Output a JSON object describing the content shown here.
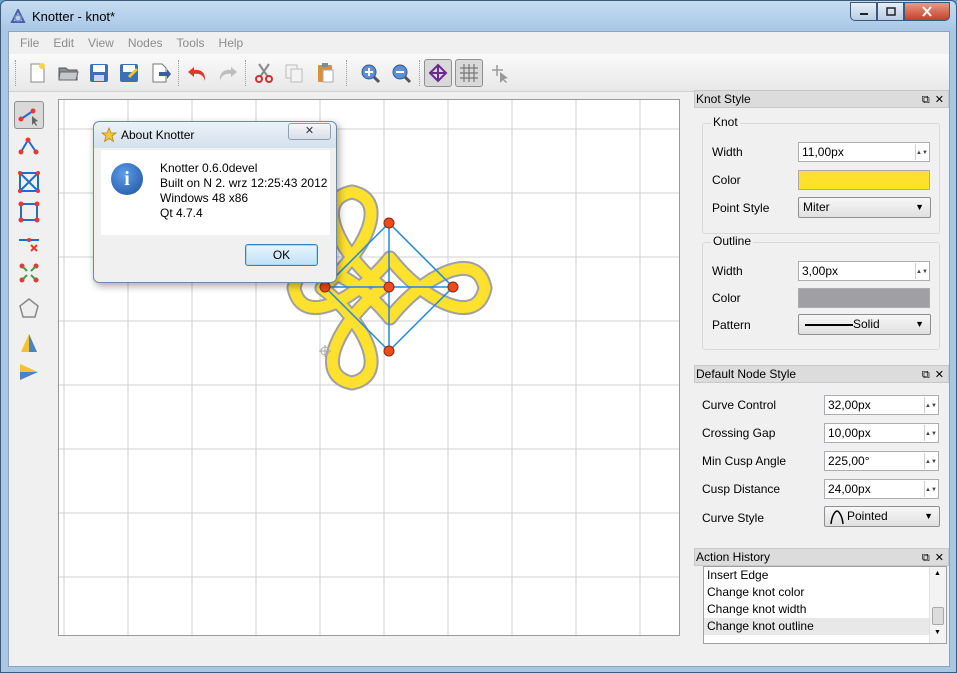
{
  "window": {
    "title": "Knotter - knot*"
  },
  "menu": [
    "File",
    "Edit",
    "View",
    "Nodes",
    "Tools",
    "Help"
  ],
  "toolbar": {
    "buttons": [
      "new-icon",
      "open-icon",
      "save-icon",
      "save-as-icon",
      "export-icon",
      "undo-icon",
      "redo-icon",
      "cut-icon",
      "copy-icon",
      "paste-icon",
      "zoom-in-icon",
      "zoom-out-icon",
      "display-graph-icon",
      "grid-icon",
      "move-grid-icon"
    ]
  },
  "knot_style": {
    "title": "Knot Style",
    "knot_group": "Knot",
    "width_label": "Width",
    "width_value": "11,00px",
    "color_label": "Color",
    "color_value": "#fde12d",
    "point_style_label": "Point Style",
    "point_style_value": "Miter",
    "outline_group": "Outline",
    "outline_width_label": "Width",
    "outline_width_value": "3,00px",
    "outline_color_label": "Color",
    "outline_color_value": "#a0a0a4",
    "pattern_label": "Pattern",
    "pattern_value": "Solid"
  },
  "node_style": {
    "title": "Default Node Style",
    "curve_control_label": "Curve Control",
    "curve_control_value": "32,00px",
    "crossing_gap_label": "Crossing Gap",
    "crossing_gap_value": "10,00px",
    "min_cusp_angle_label": "Min Cusp Angle",
    "min_cusp_angle_value": "225,00°",
    "cusp_distance_label": "Cusp Distance",
    "cusp_distance_value": "24,00px",
    "curve_style_label": "Curve Style",
    "curve_style_value": "Pointed"
  },
  "history": {
    "title": "Action History",
    "items": [
      "Insert Edge",
      "Change knot color",
      "Change knot width",
      "Change knot outline"
    ]
  },
  "about": {
    "title": "About Knotter",
    "close_label": "✕",
    "line1": "Knotter 0.6.0devel",
    "line2": "Built on N 2. wrz 12:25:43 2012",
    "line3": "Windows 48 x86",
    "line4": "Qt 4.7.4",
    "ok_label": "OK"
  },
  "colors": {
    "knot": "#fde12d",
    "outline": "#a0a0a4",
    "edge": "#1e88e5",
    "node": "#f04a1a"
  }
}
